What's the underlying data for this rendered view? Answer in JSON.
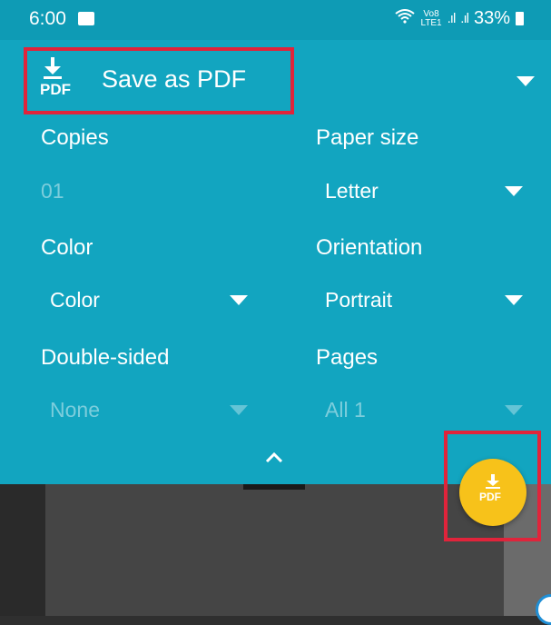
{
  "status_bar": {
    "time": "6:00",
    "network_label_top": "Vo8",
    "network_label_bottom": "LTE1",
    "battery": "33%"
  },
  "header": {
    "pdf_badge_text": "PDF",
    "printer": "Save as PDF"
  },
  "options": {
    "copies": {
      "label": "Copies",
      "value": "01"
    },
    "paper_size": {
      "label": "Paper size",
      "value": "Letter"
    },
    "color": {
      "label": "Color",
      "value": "Color"
    },
    "orientation": {
      "label": "Orientation",
      "value": "Portrait"
    },
    "double_sided": {
      "label": "Double-sided",
      "value": "None"
    },
    "pages": {
      "label": "Pages",
      "value": "All 1"
    }
  },
  "fab": {
    "text": "PDF"
  },
  "colors": {
    "panel": "#12a5c0",
    "fab": "#f7c21a",
    "highlight": "#e0243b"
  }
}
